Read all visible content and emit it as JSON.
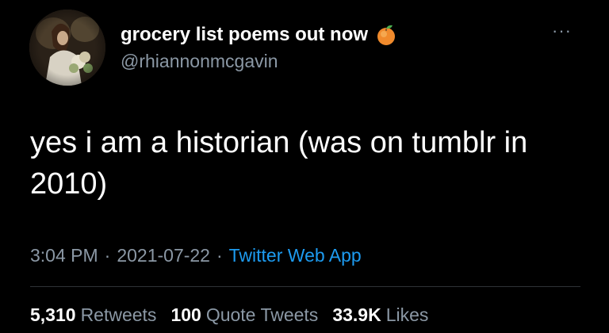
{
  "author": {
    "display_name": "grocery list poems out now",
    "name_emoji": "peach-emoji",
    "handle": "@rhiannonmcgavin"
  },
  "tweet": {
    "text": "yes i am a historian (was on tumblr in 2010)"
  },
  "meta": {
    "time": "3:04 PM",
    "separator": "·",
    "date": "2021-07-22",
    "source": "Twitter Web App"
  },
  "stats": {
    "retweets": {
      "count": "5,310",
      "label": "Retweets"
    },
    "quote_tweets": {
      "count": "100",
      "label": "Quote Tweets"
    },
    "likes": {
      "count": "33.9K",
      "label": "Likes"
    }
  },
  "icons": {
    "more": "more-options-icon"
  },
  "colors": {
    "background": "#000000",
    "primary_text": "#ffffff",
    "secondary_text": "#8b98a5",
    "link": "#1d9bf0",
    "divider": "#2f3336"
  }
}
